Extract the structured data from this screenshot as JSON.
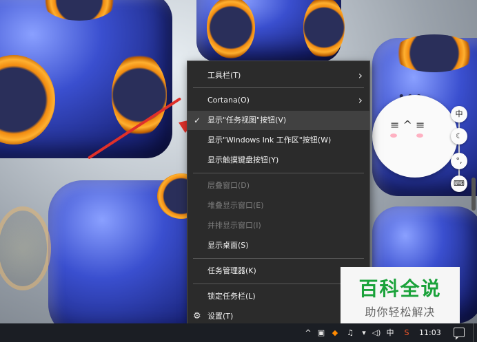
{
  "context_menu": {
    "toolbars": "工具栏(T)",
    "cortana": "Cortana(O)",
    "show_task_view": "显示\"任务视图\"按钮(V)",
    "show_ink": "显示\"Windows Ink 工作区\"按钮(W)",
    "show_touch_keyboard": "显示触摸键盘按钮(Y)",
    "cascade": "层叠窗口(D)",
    "stack": "堆叠显示窗口(E)",
    "side_by_side": "并排显示窗口(I)",
    "show_desktop": "显示桌面(S)",
    "task_manager": "任务管理器(K)",
    "lock_taskbar": "锁定任务栏(L)",
    "settings": "设置(T)",
    "submenu_arrow": "chevron-right-icon",
    "check": "checkmark-icon"
  },
  "ime_toolbar": {
    "lang": "中",
    "moon": "moon-icon",
    "punct": "punctuation-icon",
    "keyboard": "keyboard-icon"
  },
  "sticker": {
    "dots": "•••",
    "face": "≡ ^ ≡"
  },
  "watermark": {
    "title": "百科全说",
    "subtitle": "助你轻松解决"
  },
  "taskbar": {
    "tray_chevron": "^",
    "ime_lang": "中",
    "time": "11:03"
  },
  "colors": {
    "menu_bg": "#2b2b2b",
    "menu_hover": "#414141",
    "arrow": "#e0302a",
    "watermark_green": "#1aa23a",
    "taskbar": "#1b1e24"
  }
}
